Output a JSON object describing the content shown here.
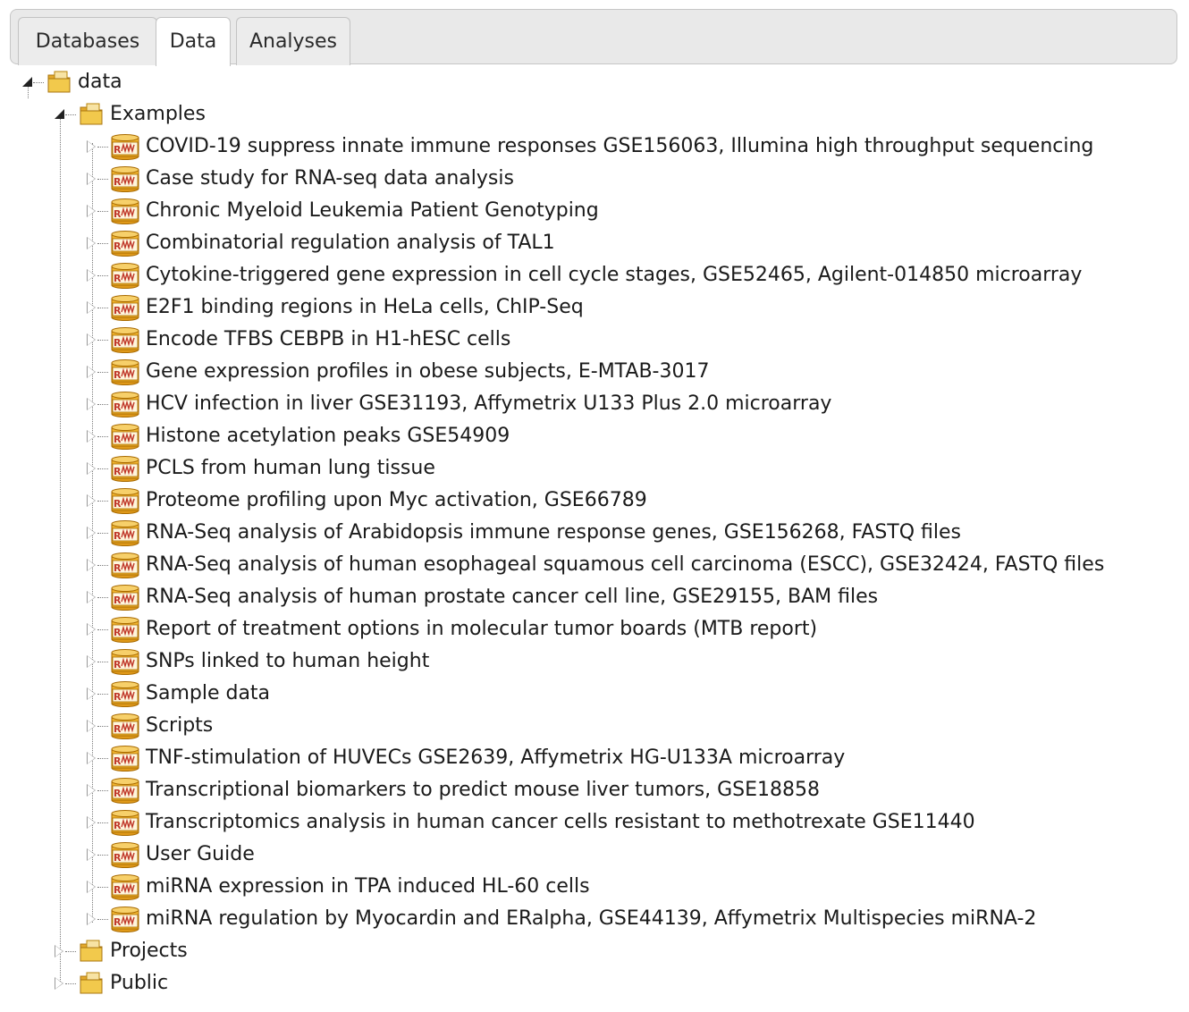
{
  "tabs": [
    {
      "label": "Databases",
      "active": false
    },
    {
      "label": "Data",
      "active": true
    },
    {
      "label": "Analyses",
      "active": false
    }
  ],
  "tree": {
    "root": {
      "label": "data",
      "icon": "folder-icon",
      "expanded": true
    },
    "folders": [
      {
        "label": "Examples",
        "icon": "folder-icon",
        "expanded": true
      },
      {
        "label": "Projects",
        "icon": "folder-icon",
        "expanded": false
      },
      {
        "label": "Public",
        "icon": "folder-icon",
        "expanded": false
      }
    ],
    "examples": [
      "COVID-19 suppress innate immune responses GSE156063, Illumina high throughput sequencing",
      "Case study for RNA-seq data analysis",
      "Chronic Myeloid Leukemia Patient Genotyping",
      "Combinatorial regulation analysis of TAL1",
      "Cytokine-triggered gene expression in cell cycle stages, GSE52465, Agilent-014850 microarray",
      "E2F1 binding regions in HeLa cells, ChIP-Seq",
      "Encode TFBS CEBPB in H1-hESC cells",
      "Gene expression profiles in obese subjects, E-MTAB-3017",
      "HCV infection in liver GSE31193, Affymetrix U133 Plus 2.0 microarray",
      "Histone acetylation peaks GSE54909",
      "PCLS from human lung tissue",
      "Proteome profiling upon Myc activation, GSE66789",
      "RNA-Seq analysis of Arabidopsis immune response genes, GSE156268, FASTQ files",
      "RNA-Seq analysis of human esophageal squamous cell carcinoma (ESCC), GSE32424, FASTQ files",
      "RNA-Seq analysis of human prostate cancer cell line, GSE29155, BAM files",
      "Report of treatment options in molecular tumor boards (MTB report)",
      "SNPs linked to human height",
      "Sample data",
      "Scripts",
      "TNF-stimulation of HUVECs GSE2639, Affymetrix HG-U133A microarray",
      "Transcriptional biomarkers to predict mouse liver tumors, GSE18858",
      "Transcriptomics analysis in human cancer cells resistant to methotrexate GSE11440",
      "User Guide",
      "miRNA expression in TPA induced HL-60 cells",
      "miRNA regulation by Myocardin and ERalpha, GSE44139, Affymetrix Multispecies miRNA-2"
    ],
    "example_icon": "database-icon"
  },
  "colors": {
    "folder": "#f2c94c",
    "database": "#f0b429",
    "database_stroke": "#b36b00",
    "database_text": "#c0392b",
    "tab_bg": "#e9e9e9",
    "tab_active_bg": "#ffffff"
  }
}
